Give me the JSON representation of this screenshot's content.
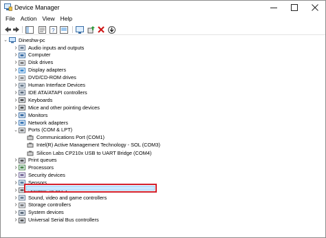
{
  "window": {
    "title": "Device Manager"
  },
  "menu": [
    "File",
    "Action",
    "View",
    "Help"
  ],
  "toolbar": [
    "back",
    "forward",
    "show-hide",
    "properties",
    "help",
    "view",
    "update-driver",
    "uninstall",
    "scan-changes"
  ],
  "tree": {
    "root": "Dineshw-pc",
    "categories": [
      "Audio inputs and outputs",
      "Computer",
      "Disk drives",
      "Display adapters",
      "DVD/CD-ROM drives",
      "Human Interface Devices",
      "IDE ATA/ATAPI controllers",
      "Keyboards",
      "Mice and other pointing devices",
      "Monitors",
      "Network adapters",
      "Ports (COM & LPT)",
      "Print queues",
      "Processors",
      "Security devices",
      "Sensors",
      "Software devices",
      "Sound, video and game controllers",
      "Storage controllers",
      "System devices",
      "Universal Serial Bus controllers"
    ],
    "ports_children": [
      "Communications Port (COM1)",
      "Intel(R) Active Management Technology - SOL (COM3)",
      "Silicon Labs CP210x USB to UART Bridge (COM4)"
    ]
  },
  "colors": {
    "highlight": "#d21f2b",
    "selection": "#cce8ff"
  }
}
